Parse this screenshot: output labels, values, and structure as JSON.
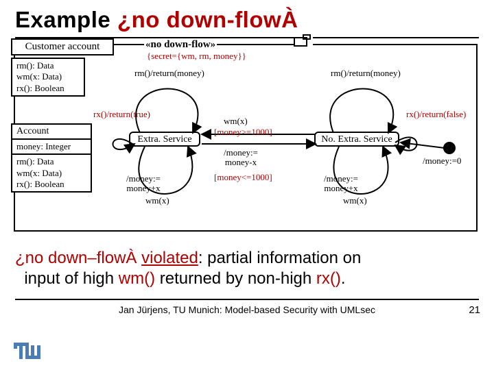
{
  "title": {
    "plain": "Example ",
    "red": "¿no down-flowÀ"
  },
  "stereotype": "«no down-flow»",
  "tag": "{secret={wm, rm, money}}",
  "classes": {
    "customer": {
      "name": "Customer account",
      "ops": [
        "rm(): Data",
        "wm(x: Data)",
        "rx(): Boolean"
      ]
    },
    "account": {
      "name": "Account",
      "attrs": [
        "money: Integer"
      ],
      "ops": [
        "rm(): Data",
        "wm(x: Data)",
        "rx(): Boolean"
      ]
    }
  },
  "states": {
    "s1": "Extra. Service",
    "s2": "No. Extra. Service"
  },
  "transitions": {
    "rm_return_left": "rm()/return(money)",
    "rx_true": "rx()/return(true)",
    "wmx_left": "wm(x)",
    "eff_left": "/money:=\nmoney+x",
    "rm_return_right": "rm()/return(money)",
    "rx_false": "rx()/return(false)",
    "wmx_right_top": "wm(x)",
    "guard_ge": "[money>=1000]",
    "eff_mid": "/money:=\nmoney-x",
    "guard_le": "[money<=1000]",
    "wmx_right": "wm(x)",
    "eff_right": "/money:=\nmoney+x",
    "init": "/money:=0"
  },
  "caption": {
    "p1a": "¿no down–flowÀ ",
    "p1b": "violated",
    "p1c": ": partial information on",
    "p2a": "input of high ",
    "p2b": "wm()",
    "p2c": " returned by non-high ",
    "p2d": "rx()",
    "p2e": "."
  },
  "footer": {
    "text": "Jan Jürjens, TU Munich: Model-based Security with UMLsec",
    "page": "21"
  }
}
